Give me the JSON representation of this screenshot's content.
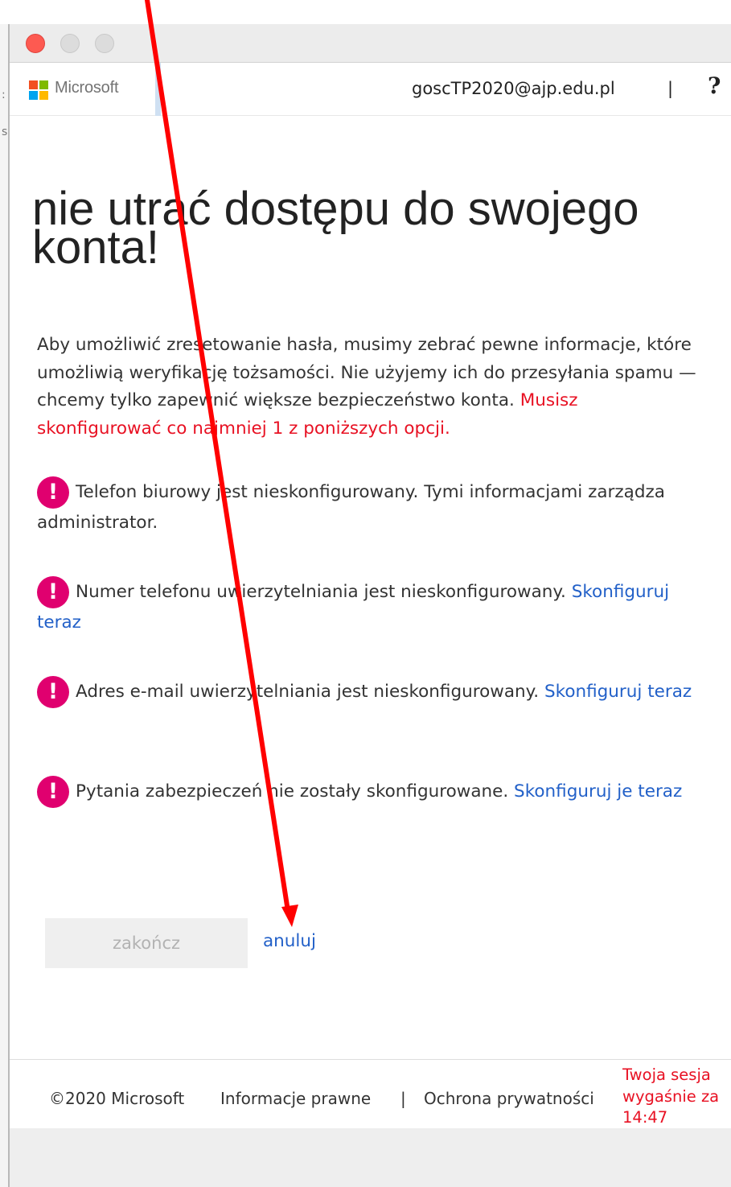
{
  "header": {
    "brand": "Microsoft",
    "user_email": "goscTP2020@ajp.edu.pl",
    "separator": "|",
    "help_glyph": "?"
  },
  "left_strip": {
    "fragments": [
      ":",
      "s"
    ]
  },
  "main": {
    "title": "nie utrać dostępu do swojego konta!",
    "intro": "Aby umożliwić zresetowanie hasła, musimy zebrać pewne informacje, które umożliwią weryfikację tożsamości. Nie użyjemy ich do przesyłania spamu — chcemy tylko zapewnić większe bezpieczeństwo konta.",
    "intro_required": "Musisz skonfigurować co najmniej 1 z poniższych opcji.",
    "alert_glyph": "!",
    "items": [
      {
        "text": "Telefon biurowy jest nieskonfigurowany. Tymi informacjami zarządza administrator.",
        "link": ""
      },
      {
        "text": "Numer telefonu uwierzytelniania jest nieskonfigurowany.",
        "link": "Skonfiguruj teraz"
      },
      {
        "text": "Adres e-mail uwierzytelniania jest nieskonfigurowany.",
        "link": "Skonfiguruj teraz"
      },
      {
        "text": "Pytania zabezpieczeń nie zostały skonfigurowane.",
        "link": "Skonfiguruj je teraz"
      }
    ],
    "finish_label": "zakończ",
    "cancel_label": "anuluj"
  },
  "footer": {
    "copyright": "©2020 Microsoft",
    "legal": "Informacje prawne",
    "separator": "|",
    "privacy": "Ochrona prywatności",
    "session_line1": "Twoja sesja",
    "session_line2": "wygaśnie za",
    "session_line3": "14:47"
  },
  "colors": {
    "accent_link": "#2260c8",
    "required_red": "#e81123",
    "alert_magenta": "#e0006f",
    "annotation_arrow": "#ff0000"
  }
}
